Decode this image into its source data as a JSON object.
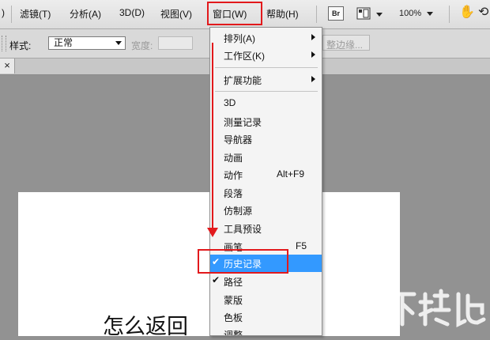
{
  "menubar": {
    "items": [
      {
        "label": ")"
      },
      {
        "label": "滤镜(T)"
      },
      {
        "label": "分析(A)"
      },
      {
        "label": "3D(D)"
      },
      {
        "label": "视图(V)"
      },
      {
        "label": "窗口(W)"
      },
      {
        "label": "帮助(H)"
      }
    ],
    "bridge_label": "Br",
    "zoom": "100%"
  },
  "optionsbar": {
    "style_label": "样式:",
    "style_value": "正常",
    "width_label": "宽度:",
    "refine_edge": "整边缘..."
  },
  "tab": {
    "close_glyph": "×"
  },
  "window_menu": {
    "items": [
      {
        "label": "排列(A)",
        "submenu": true
      },
      {
        "label": "工作区(K)",
        "submenu": true
      },
      {
        "label": "扩展功能",
        "submenu": true
      },
      {
        "label": "3D"
      },
      {
        "label": "测量记录"
      },
      {
        "label": "导航器"
      },
      {
        "label": "动画"
      },
      {
        "label": "动作",
        "shortcut": "Alt+F9"
      },
      {
        "label": "段落"
      },
      {
        "label": "仿制源"
      },
      {
        "label": "工具预设"
      },
      {
        "label": "画笔",
        "shortcut": "F5"
      },
      {
        "label": "历史记录",
        "checked": true,
        "highlighted": true
      },
      {
        "label": "路径",
        "checked": true
      },
      {
        "label": "蒙版"
      },
      {
        "label": "色板"
      },
      {
        "label": "调整"
      }
    ],
    "check_glyph": "✔"
  },
  "document": {
    "text": "怎么返回"
  },
  "watermark": {
    "text": "下载吧"
  },
  "colors": {
    "highlight": "#e2191c",
    "selection": "#3399ff"
  }
}
